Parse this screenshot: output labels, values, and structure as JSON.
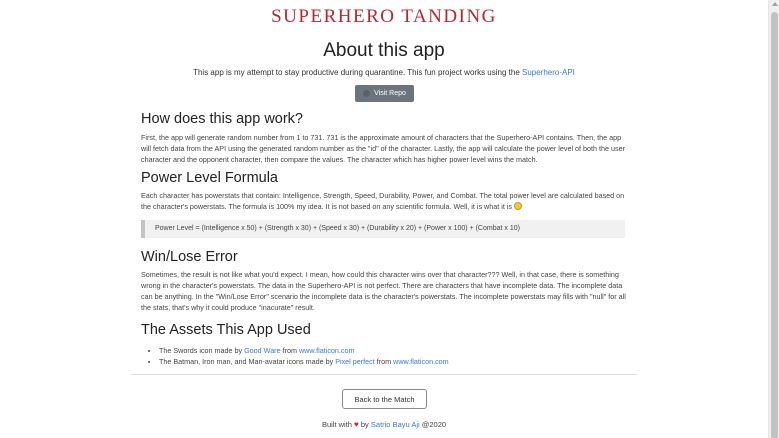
{
  "brand": "SUPERHERO TANDING",
  "about": {
    "title": "About this app",
    "text_before": "This app is my attempt to stay productive during quarantine. This fun project works using the ",
    "api_link": "Superhero-API",
    "visit_label": "Visit Repo"
  },
  "how": {
    "title": "How does this app work?",
    "body": "First, the app will generate random number from 1 to 731. 731 is the approximate amount of characters that the Superhero-API contains. Then, the app will fetch data from the API using the generated random number as the \"id\" of the character. Lastly, the app will calculate the power level of both the user character and the opponent character, then compare the values. The character which has higher power level wins the match."
  },
  "power": {
    "title": "Power Level Formula",
    "body": "Each character has powerstats that contain: Intelligence, Strength, Speed, Durability, Power, and Combat. The total power level are calculated based on the character's powerstats. The formula is 100% my idea. It is not based on any scientific formula. Well, it is what it is ",
    "formula": "Power Level = (Intelligence x 50) + (Strength x 30) + (Speed x 30) + (Durability x 20) + (Power x 100) + (Combat x 10)"
  },
  "winlose": {
    "title": "Win/Lose Error",
    "body": "Sometimes, the result is not like what you'd expect. I mean, how could this character wins over that character??? Well, in that case, there is something wrong in the character's powerstats. The data in the Superhero-API is not perfect. There are characters that have incomplete data. The incomplete data can be anything. In the \"Win/Lose Error\" scenario the incomplete data is the character's powerstats. The incomplete powerstats may fills with \"null\" for all the stats, that's why it could produce \"inacurate\" result."
  },
  "assets": {
    "title": "The Assets This App Used",
    "item1_prefix": "The Swords icon made by ",
    "item1_author": "Good Ware",
    "item1_mid": " from ",
    "item1_site": "www.flaticon.com",
    "item2_prefix": "The Batman, Iron man, and Man-avatar icons made by ",
    "item2_author": "Pixel perfect",
    "item2_mid": " from ",
    "item2_site": "www.flaticon.com"
  },
  "back_label": "Back to the Match",
  "footer": {
    "prefix": "Built with ",
    "heart": "♥",
    "by": " by ",
    "author": "Satrio Bayu Aji",
    "year": " @2020"
  },
  "colors": {
    "brand": "#b8262f",
    "link": "#3a7bd5",
    "button": "#6c757d"
  }
}
